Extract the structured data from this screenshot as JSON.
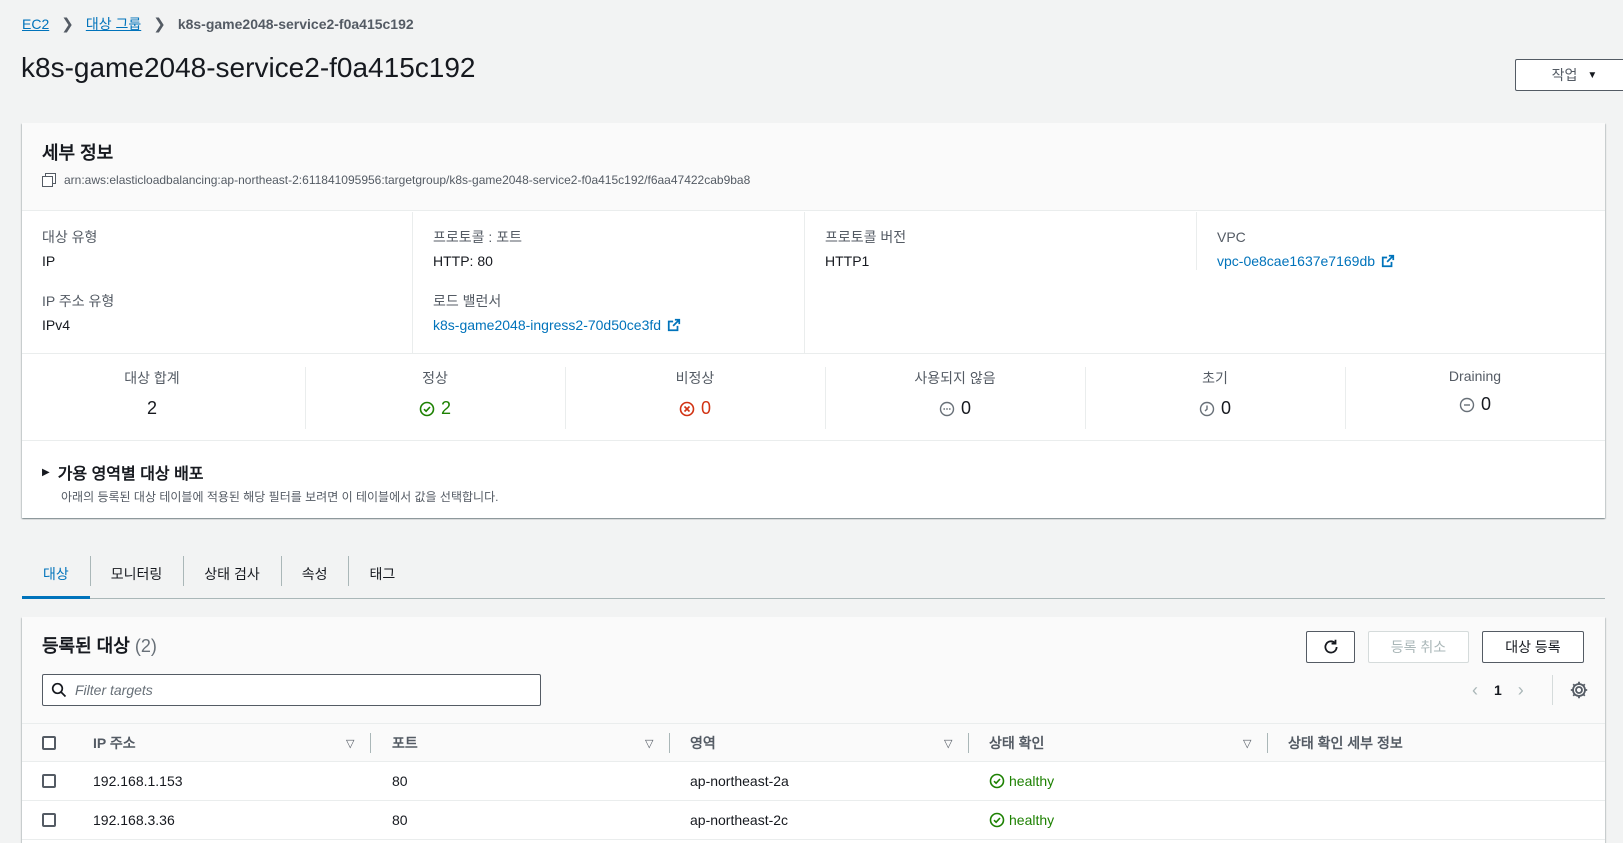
{
  "breadcrumb": {
    "ec2": "EC2",
    "target_groups": "대상 그룹",
    "current": "k8s-game2048-service2-f0a415c192"
  },
  "page_title": "k8s-game2048-service2-f0a415c192",
  "actions_label": "작업",
  "details": {
    "title": "세부 정보",
    "arn": "arn:aws:elasticloadbalancing:ap-northeast-2:611841095956:targetgroup/k8s-game2048-service2-f0a415c192/f6aa47422cab9ba8",
    "target_type_label": "대상 유형",
    "target_type": "IP",
    "ip_type_label": "IP 주소 유형",
    "ip_type": "IPv4",
    "protocol_port_label": "프로토콜 : 포트",
    "protocol_port": "HTTP: 80",
    "load_balancer_label": "로드 밸런서",
    "load_balancer": "k8s-game2048-ingress2-70d50ce3fd",
    "protocol_version_label": "프로토콜 버전",
    "protocol_version": "HTTP1",
    "vpc_label": "VPC",
    "vpc": "vpc-0e8cae1637e7169db"
  },
  "counts": {
    "total_label": "대상 합계",
    "total": "2",
    "healthy_label": "정상",
    "healthy": "2",
    "unhealthy_label": "비정상",
    "unhealthy": "0",
    "unused_label": "사용되지 않음",
    "unused": "0",
    "initial_label": "초기",
    "initial": "0",
    "draining_label": "Draining",
    "draining": "0"
  },
  "az": {
    "title": "가용 영역별 대상 배포",
    "desc": "아래의 등록된 대상 테이블에 적용된 해당 필터를 보려면 이 테이블에서 값을 선택합니다."
  },
  "tabs": [
    "대상",
    "모니터링",
    "상태 검사",
    "속성",
    "태그"
  ],
  "targets": {
    "title": "등록된 대상",
    "count": "(2)",
    "deregister_label": "등록 취소",
    "register_label": "대상 등록",
    "filter_placeholder": "Filter targets",
    "page": "1",
    "columns": [
      "IP 주소",
      "포트",
      "영역",
      "상태 확인",
      "상태 확인 세부 정보"
    ],
    "rows": [
      {
        "ip": "192.168.1.153",
        "port": "80",
        "zone": "ap-northeast-2a",
        "health": "healthy",
        "details": ""
      },
      {
        "ip": "192.168.3.36",
        "port": "80",
        "zone": "ap-northeast-2c",
        "health": "healthy",
        "details": ""
      }
    ]
  },
  "colors": {
    "link": "#0073bb",
    "healthy": "#1d8102",
    "unhealthy": "#d13212"
  }
}
